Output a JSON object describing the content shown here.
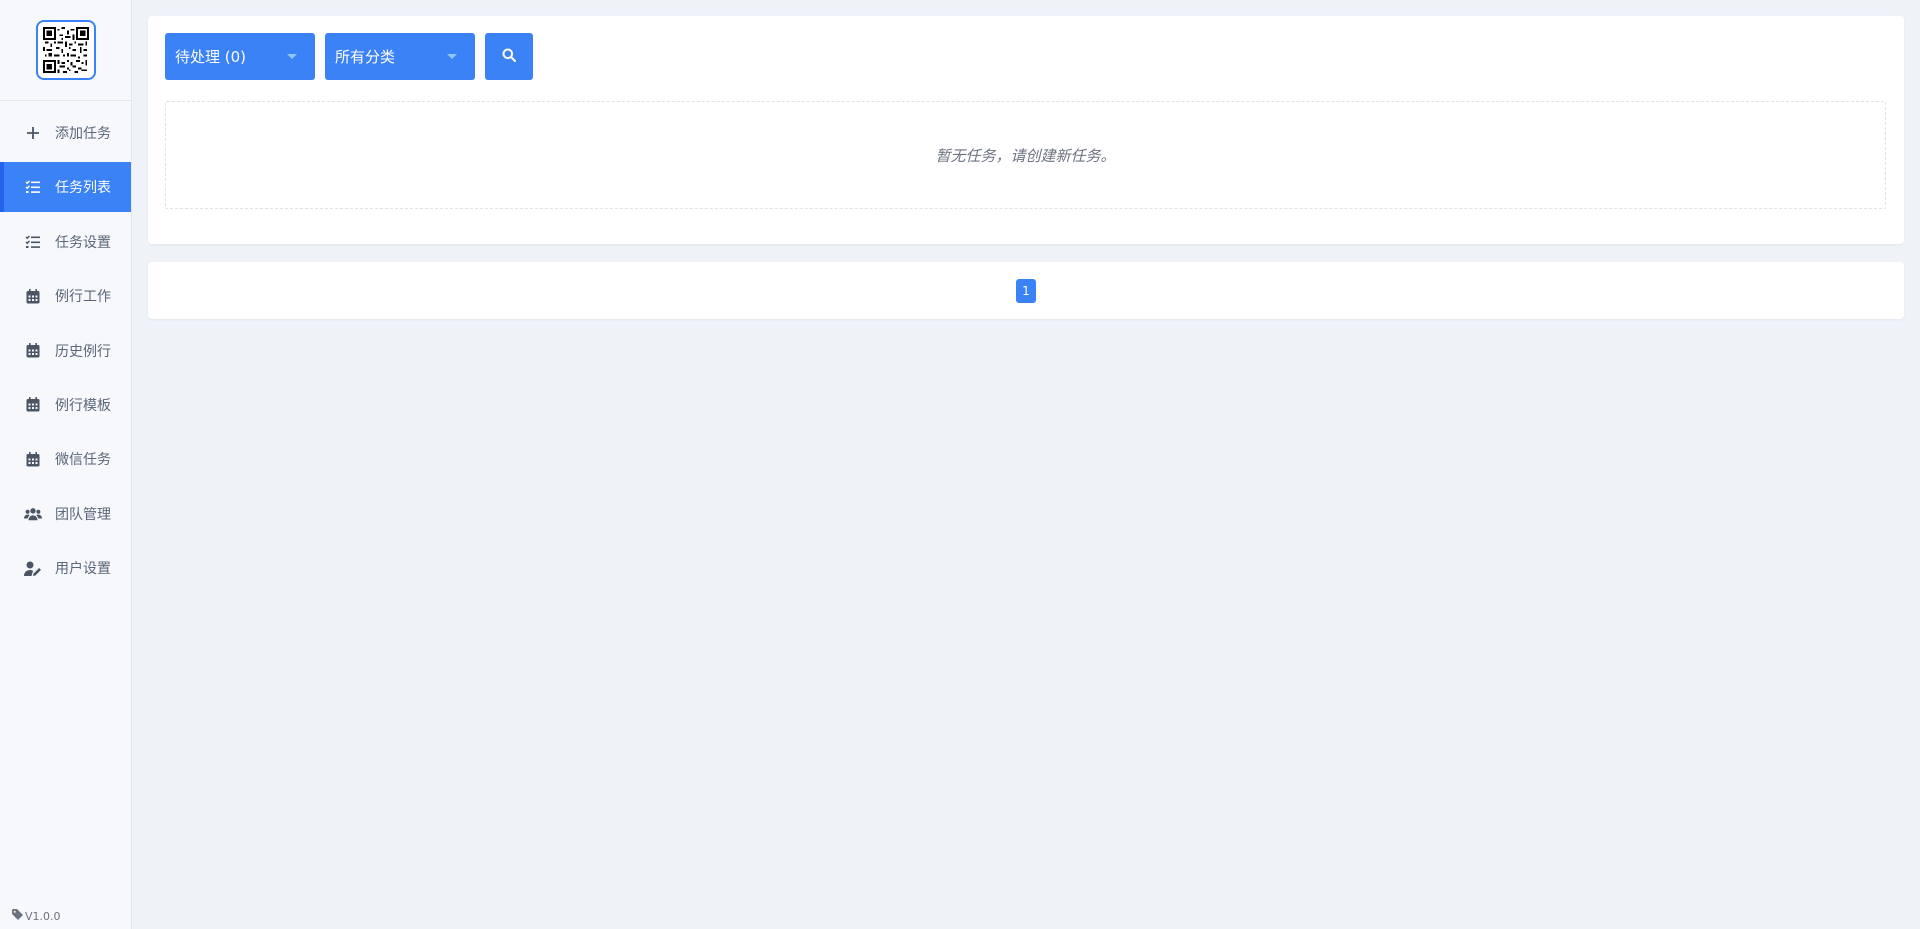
{
  "sidebar": {
    "items": [
      {
        "label": "添加任务",
        "icon": "plus-icon",
        "active": false
      },
      {
        "label": "任务列表",
        "icon": "task-list-icon",
        "active": true
      },
      {
        "label": "任务设置",
        "icon": "task-settings-icon",
        "active": false
      },
      {
        "label": "例行工作",
        "icon": "calendar-icon",
        "active": false
      },
      {
        "label": "历史例行",
        "icon": "calendar-icon",
        "active": false
      },
      {
        "label": "例行模板",
        "icon": "calendar-icon",
        "active": false
      },
      {
        "label": "微信任务",
        "icon": "calendar-icon",
        "active": false
      },
      {
        "label": "团队管理",
        "icon": "users-icon",
        "active": false
      },
      {
        "label": "用户设置",
        "icon": "user-edit-icon",
        "active": false
      }
    ],
    "version": "V1.0.0"
  },
  "toolbar": {
    "status_select": "待处理 (0)",
    "category_select": "所有分类"
  },
  "main": {
    "empty_message": "暂无任务，请创建新任务。"
  },
  "pagination": {
    "current_page": "1"
  },
  "colors": {
    "accent": "#3b82f6",
    "background": "#eff3f8",
    "sidebar": "#f6f8fb"
  }
}
